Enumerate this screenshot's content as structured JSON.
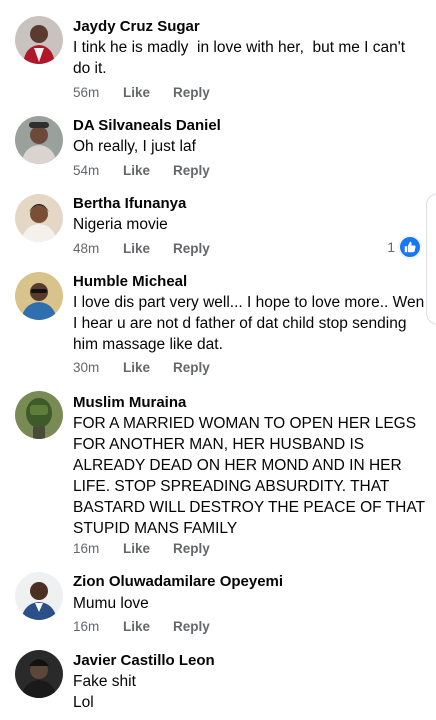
{
  "actions": {
    "like": "Like",
    "reply": "Reply"
  },
  "comments": [
    {
      "name": "Jaydy Cruz Sugar",
      "text": "I tink he is madly  in love with her,  but me I can't do it.",
      "time": "56m"
    },
    {
      "name": "DA Silvaneals Daniel",
      "text": "Oh really, I just laf",
      "time": "54m"
    },
    {
      "name": "Bertha Ifunanya",
      "text": "Nigeria movie",
      "time": "48m",
      "reaction_count": "1"
    },
    {
      "name": "Humble Micheal",
      "text": "I love dis part very well... I hope to love more.. Wen I hear u are not d father of dat child stop sending him massage like dat.",
      "time": "30m"
    },
    {
      "name": "Muslim Muraina",
      "text": "FOR A MARRIED WOMAN TO OPEN HER LEGS FOR ANOTHER MAN, HER HUSBAND IS ALREADY DEAD ON HER MOND AND IN HER LIFE. STOP SPREADING ABSURDITY. THAT BASTARD WILL DESTROY THE PEACE OF THAT STUPID MANS FAMILY",
      "time": "16m"
    },
    {
      "name": "Zion Oluwadamilare Opeyemi",
      "text": "Mumu love",
      "time": "16m"
    },
    {
      "name": "Javier Castillo Leon",
      "text": "Fake shit\nLol"
    }
  ],
  "colors": {
    "accent": "#1877f2",
    "meta": "#65676b"
  },
  "icons": {
    "reaction": "thumbs-up-icon"
  }
}
